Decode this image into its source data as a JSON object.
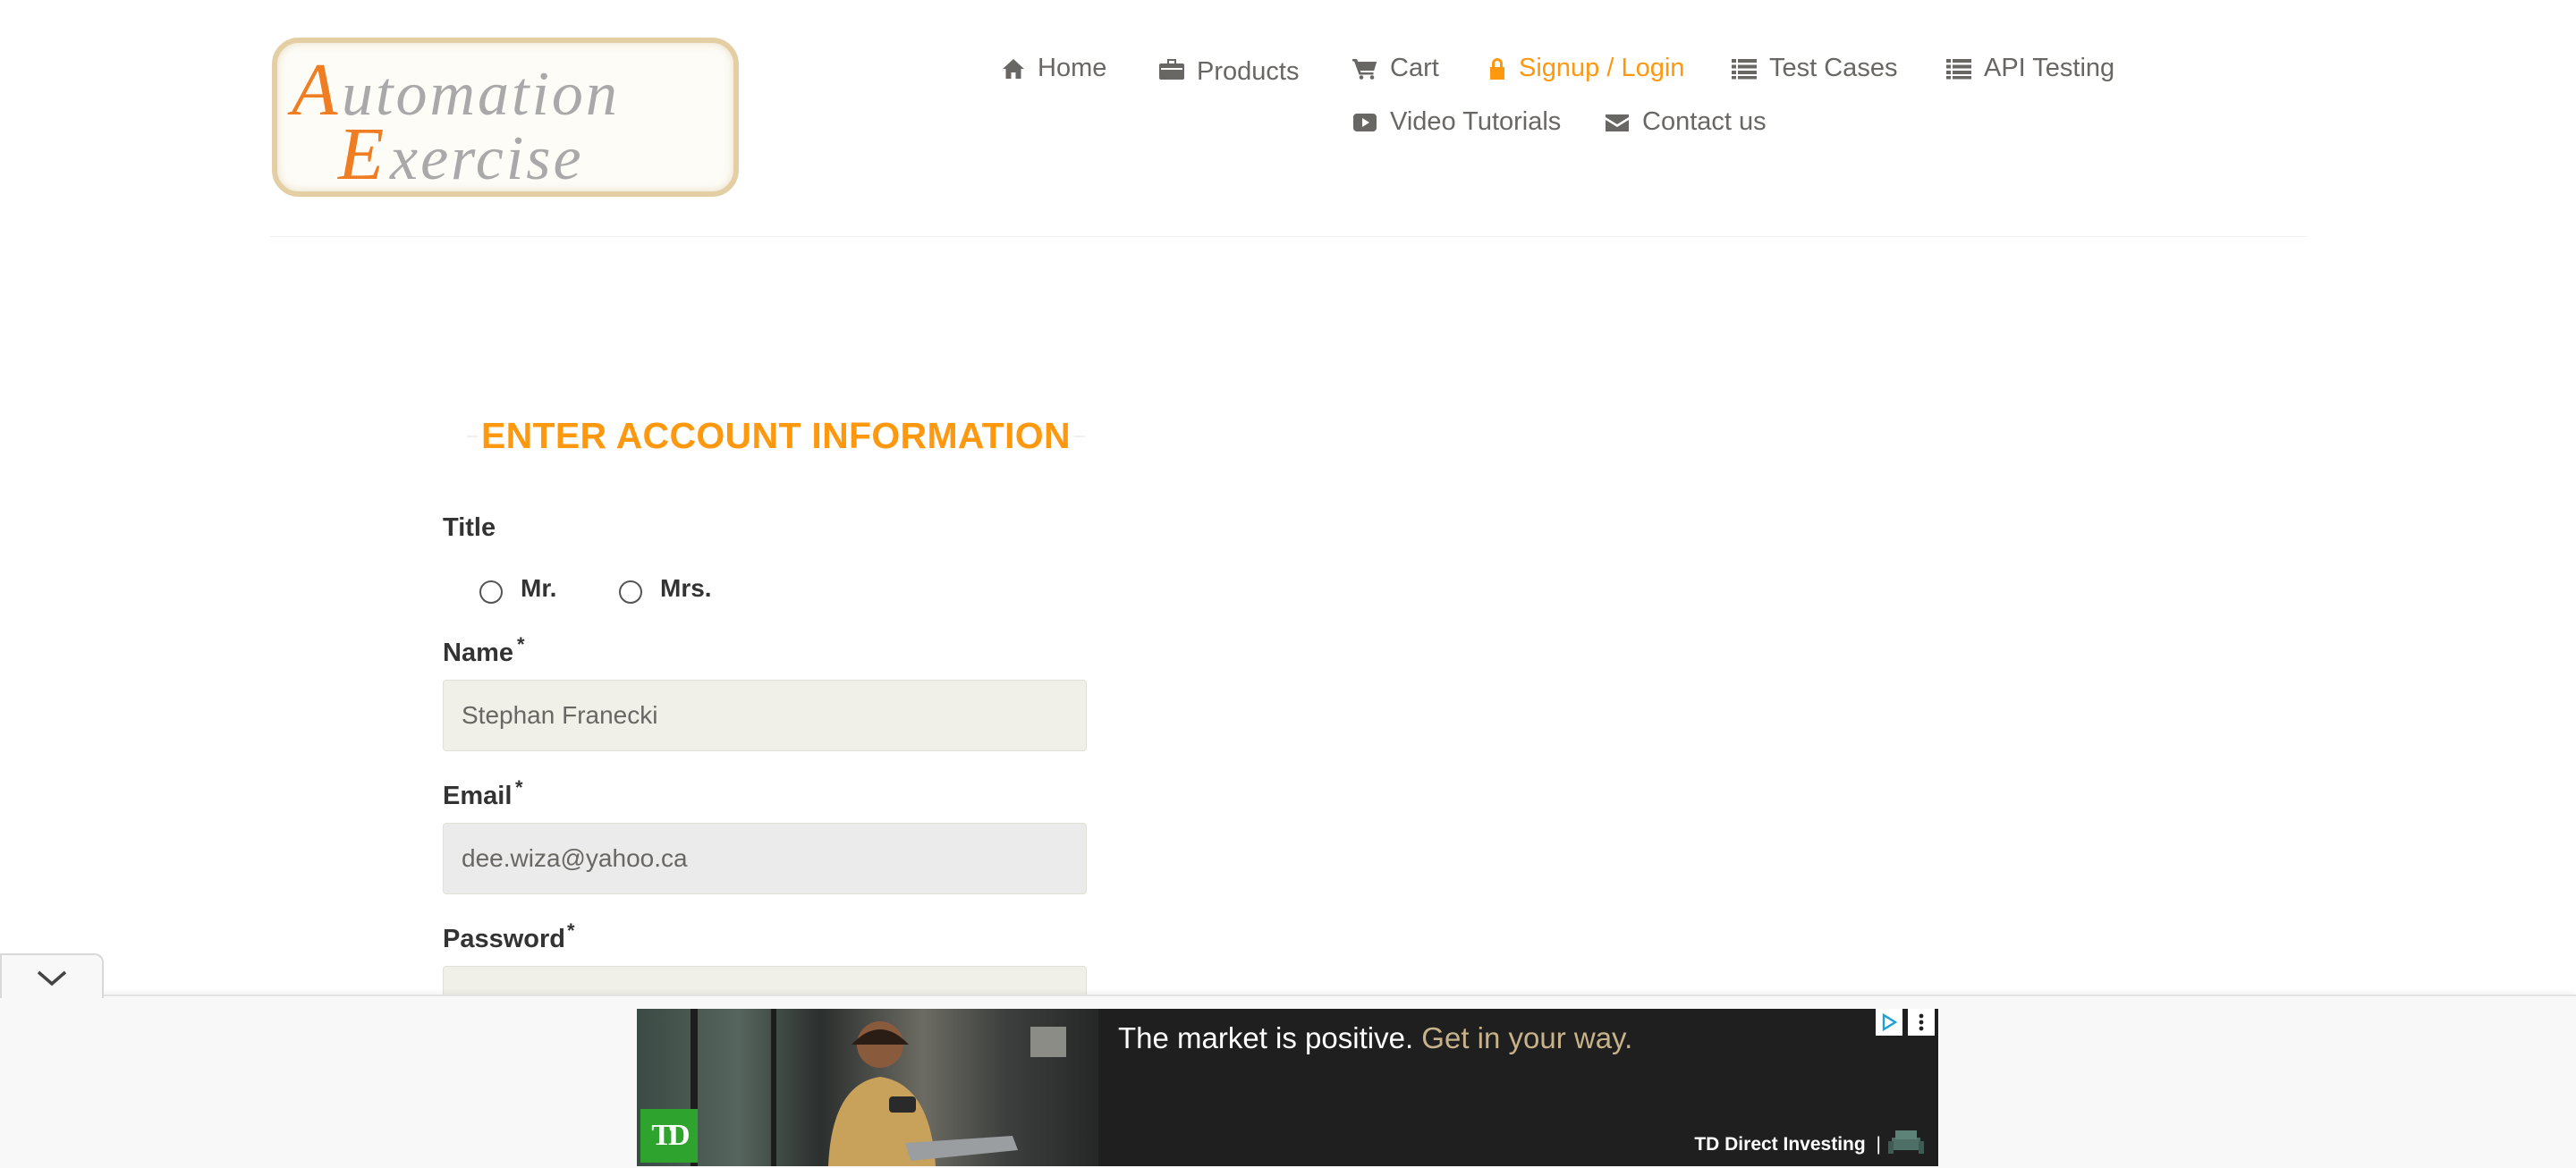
{
  "header": {
    "logo": {
      "line1": "Automation",
      "line2": "Exercise"
    },
    "nav": [
      {
        "label": "Home",
        "icon": "home-icon"
      },
      {
        "label": "Products",
        "icon": "briefcase-icon"
      },
      {
        "label": "Cart",
        "icon": "cart-icon"
      },
      {
        "label": "Signup / Login",
        "icon": "lock-icon",
        "active": true
      },
      {
        "label": "Test Cases",
        "icon": "list-icon"
      },
      {
        "label": "API Testing",
        "icon": "list-icon"
      },
      {
        "label": "Video Tutorials",
        "icon": "youtube-play-icon"
      },
      {
        "label": "Contact us",
        "icon": "envelope-icon"
      }
    ],
    "accent_color": "#fe980f"
  },
  "form": {
    "title": "ENTER ACCOUNT INFORMATION",
    "title_label": "Title",
    "title_options": [
      {
        "label": "Mr.",
        "checked": false
      },
      {
        "label": "Mrs.",
        "checked": false
      }
    ],
    "name": {
      "label": "Name",
      "required_mark": "*",
      "value": "Stephan Franecki"
    },
    "email": {
      "label": "Email",
      "required_mark": "*",
      "value": "dee.wiza@yahoo.ca"
    },
    "password": {
      "label": "Password",
      "required_mark": "*",
      "value": ""
    }
  },
  "ad": {
    "headline": "The market is positive.",
    "cta": "Get in your way.",
    "brand": "TD Direct Investing",
    "logo_text": "TD",
    "collapse_icon": "chevron-down-icon"
  }
}
